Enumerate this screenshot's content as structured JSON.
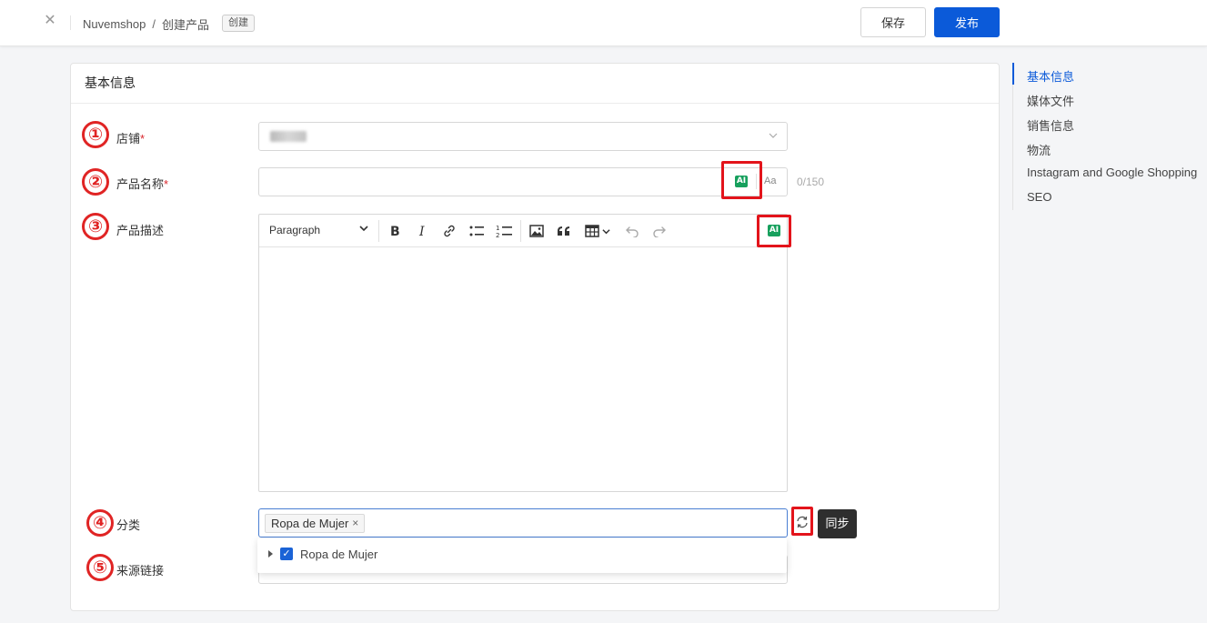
{
  "header": {
    "breadcrumb_root": "Nuvemshop",
    "breadcrumb_sep": "/",
    "breadcrumb_page": "创建产品",
    "status_tag": "创建",
    "save_label": "保存",
    "publish_label": "发布",
    "close_icon": "close-icon"
  },
  "card": {
    "title": "基本信息"
  },
  "fields": {
    "store": {
      "num": "①",
      "label": "店铺",
      "required": "*"
    },
    "product_name": {
      "num": "②",
      "label": "产品名称",
      "required": "*",
      "ai_label": "AI",
      "case_label": "Aa",
      "counter": "0/150"
    },
    "description": {
      "num": "③",
      "label": "产品描述",
      "format_label": "Paragraph",
      "ai_label": "AI"
    },
    "category": {
      "num": "④",
      "label": "分类",
      "tag": "Ropa de Mujer",
      "sync_tooltip": "同步",
      "option": "Ropa de Mujer"
    },
    "source_link": {
      "num": "⑤",
      "label": "来源链接"
    }
  },
  "side_nav": {
    "items": [
      {
        "label": "基本信息"
      },
      {
        "label": "媒体文件"
      },
      {
        "label": "销售信息"
      },
      {
        "label": "物流"
      },
      {
        "label": "Instagram and Google Shopping"
      },
      {
        "label": "SEO"
      }
    ]
  },
  "colors": {
    "primary": "#0b5ad9",
    "highlight_red": "#e3141b",
    "ai_green": "#17a05d"
  }
}
